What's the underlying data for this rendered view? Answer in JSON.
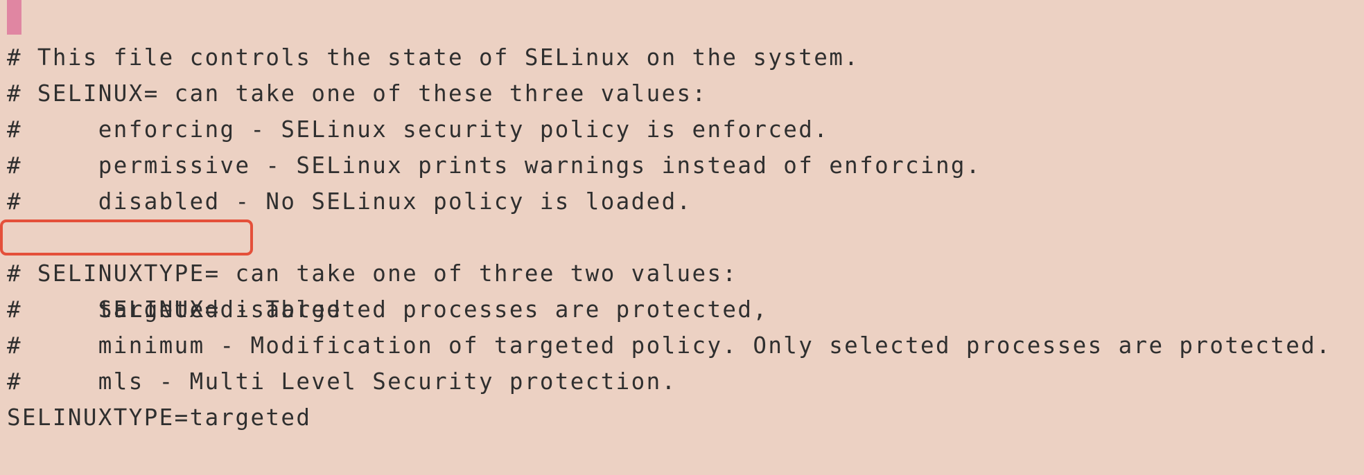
{
  "editor": {
    "lines": [
      "# This file controls the state of SELinux on the system.",
      "# SELINUX= can take one of these three values:",
      "#     enforcing - SELinux security policy is enforced.",
      "#     permissive - SELinux prints warnings instead of enforcing.",
      "#     disabled - No SELinux policy is loaded.",
      "SELINUX=disabled",
      "# SELINUXTYPE= can take one of three two values:",
      "#     targeted - Targeted processes are protected,",
      "#     minimum - Modification of targeted policy. Only selected processes are protected.",
      "#     mls - Multi Level Security protection.",
      "SELINUXTYPE=targeted"
    ],
    "highlighted_line": 5
  },
  "colors": {
    "background": "#ecd1c3",
    "text": "#2f2f2f",
    "cursor": "#e086a2",
    "highlight_border": "#e4503a"
  }
}
